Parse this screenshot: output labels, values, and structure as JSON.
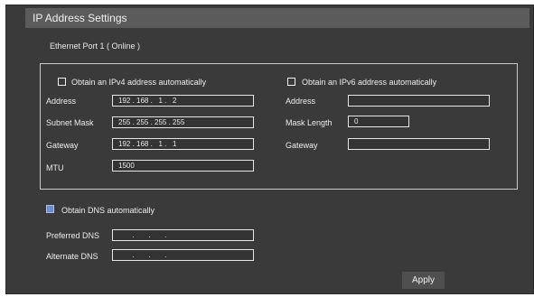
{
  "window": {
    "title": "IP Address Settings"
  },
  "ethernet": {
    "port_label": "Ethernet Port 1 ( Online )"
  },
  "ipv4": {
    "auto_label": "Obtain an IPv4 address automatically",
    "address_label": "Address",
    "address_value": "192 . 168 .   1 .   2",
    "subnet_label": "Subnet Mask",
    "subnet_value": "255 . 255 . 255 . 255",
    "gateway_label": "Gateway",
    "gateway_value": "192 . 168 .   1 .   1",
    "mtu_label": "MTU",
    "mtu_value": "1500"
  },
  "ipv6": {
    "auto_label": "Obtain an IPv6 address automatically",
    "address_label": "Address",
    "address_value": "",
    "mask_label": "Mask Length",
    "mask_value": "0",
    "gateway_label": "Gateway",
    "gateway_value": ""
  },
  "dns": {
    "auto_label": "Obtain DNS automatically",
    "preferred_label": "Preferred DNS",
    "preferred_value": "       .       .       .",
    "alternate_label": "Alternate DNS",
    "alternate_value": "       .       .       ."
  },
  "actions": {
    "apply_label": "Apply"
  }
}
